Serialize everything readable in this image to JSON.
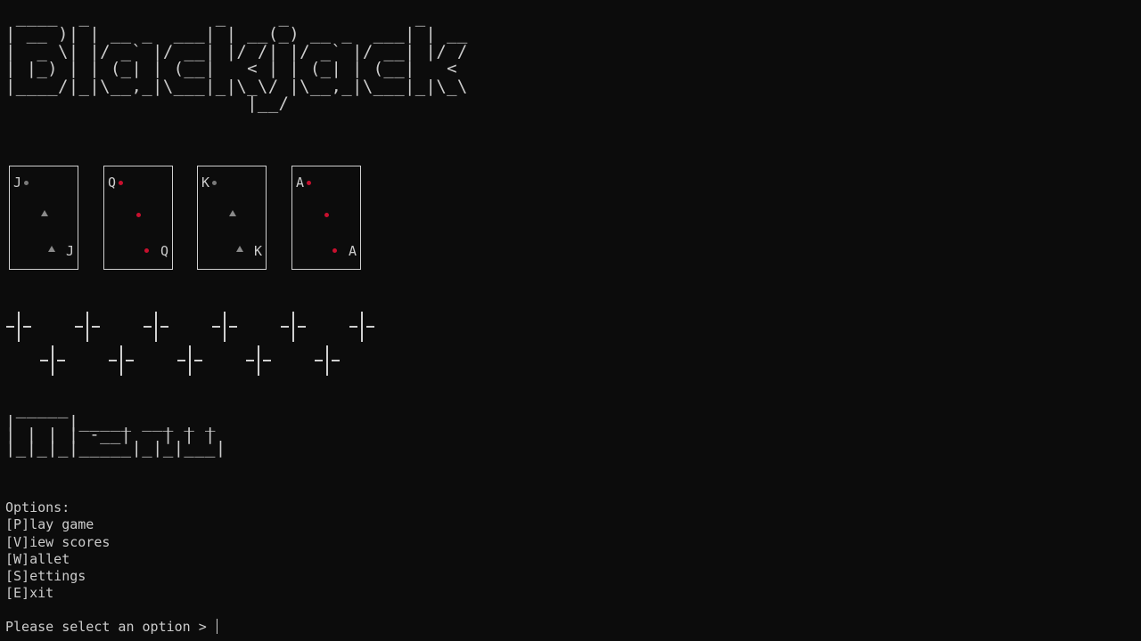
{
  "terminal": {
    "background": "#0c0c0c",
    "foreground": "#cccccc"
  },
  "title_art": " ____  _            _     _            _    \n| __ )| | __ _  ___| | __(_) __ _  ___| | __\n|  _ \\| |/ _` |/ __| |/ /| |/ _` |/ __| |/ /\n| |_) | | (_| | (__|   < | | (_| | (__|   < \n|____/|_|\\__,_|\\___|_|\\_\\/ |\\__,_|\\___|_|\\_\\\n                       |__/                  ",
  "cards": [
    {
      "rank": "J",
      "suit_icon": "spade-icon",
      "suit_color": "#7a7a7a"
    },
    {
      "rank": "Q",
      "suit_icon": "heart-icon",
      "suit_color": "#c8102e"
    },
    {
      "rank": "K",
      "suit_icon": "spade-icon",
      "suit_color": "#7a7a7a"
    },
    {
      "rank": "A",
      "suit_icon": "diamond-icon",
      "suit_color": "#c8102e"
    }
  ],
  "sparkle_icon": "sparkle-cross-icon",
  "menu_art": " _____\n|     |_____ ___ _ _ \n| | | | -__|   | | |\n|_|_|_|_____|_|_|___|",
  "options": {
    "header": "Options:",
    "items": [
      "[P]lay game",
      "[V]iew scores",
      "[W]allet",
      "[S]ettings",
      "[E]xit"
    ]
  },
  "prompt": {
    "text": "Please select an option > "
  }
}
